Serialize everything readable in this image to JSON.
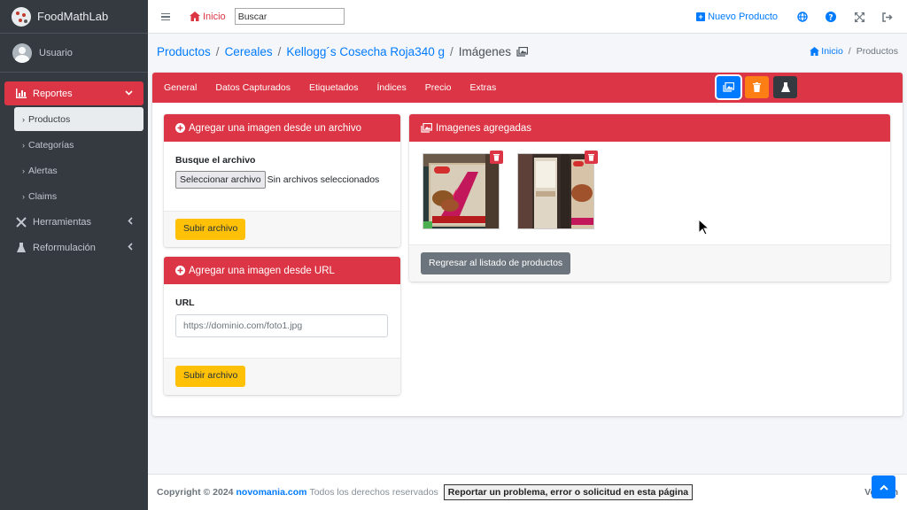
{
  "sidebar": {
    "brand": "FoodMathLab",
    "user": "Usuario",
    "items": [
      {
        "label": "Reportes",
        "icon": "chart-icon",
        "active": true
      },
      {
        "label": "Herramientas",
        "icon": "tools-icon"
      },
      {
        "label": "Reformulación",
        "icon": "flask-icon"
      }
    ],
    "subitems": [
      "Productos",
      "Categorías",
      "Alertas",
      "Claims"
    ]
  },
  "topbar": {
    "home": "Inicio",
    "search_placeholder": "Buscar",
    "new_product": "Nuevo Producto",
    "icons": [
      "globe-icon",
      "help-icon",
      "fullscreen-icon",
      "logout-icon"
    ]
  },
  "breadcrumb": {
    "items": [
      "Productos",
      "Cereales",
      "Kellogg´s Cosecha Roja340 g"
    ],
    "current": "Imágenes",
    "right_home": "Inicio",
    "right_current": "Productos"
  },
  "tabs": [
    "General",
    "Datos Capturados",
    "Etiquetados",
    "Índices",
    "Precio",
    "Extras"
  ],
  "upload_file": {
    "title": "Agregar una imagen desde un archivo",
    "label": "Busque el archivo",
    "choose_button": "Seleccionar archivo",
    "no_file": "Sin archivos seleccionados",
    "submit": "Subir archivo"
  },
  "upload_url": {
    "title": "Agregar una imagen desde URL",
    "label": "URL",
    "placeholder": "https://dominio.com/foto1.jpg",
    "submit": "Subir archivo"
  },
  "images": {
    "title": "Imagenes agregadas",
    "back_button": "Regresar al listado de productos"
  },
  "footer": {
    "copyright": "Copyright © 2024",
    "company": "novomania.com",
    "rights": "Todos los derechos reservados",
    "report_button": "Reportar un problema, error o solicitud en esta página",
    "version": "Versión"
  },
  "colors": {
    "accent": "#dc3545",
    "primary": "#007bff",
    "sidebar": "#343a40",
    "warning": "#ffc107"
  }
}
